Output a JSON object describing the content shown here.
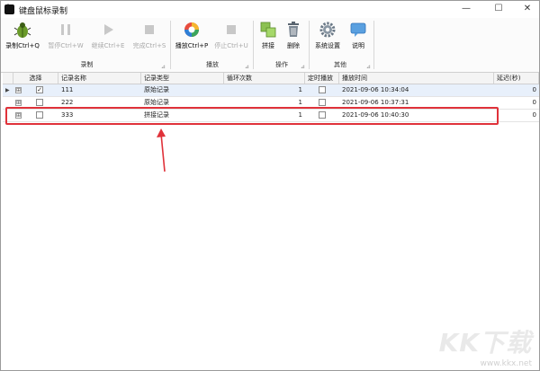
{
  "window": {
    "title": "键盘鼠标录制"
  },
  "title_buttons": {
    "minimize": "—",
    "maximize": "☐",
    "close": "✕"
  },
  "toolbar": {
    "record": "录制Ctrl+Q",
    "pause": "暂停Ctrl+W",
    "resume": "继续Ctrl+E",
    "finish": "完成Ctrl+S",
    "play": "播放Ctrl+P",
    "stop": "停止Ctrl+U",
    "splice": "拼接",
    "delete": "删除",
    "settings": "系统设置",
    "help": "说明"
  },
  "groups": {
    "record": "录制",
    "play": "播放",
    "operate": "操作",
    "other": "其他"
  },
  "table": {
    "columns": [
      "选择",
      "记录名称",
      "记录类型",
      "循环次数",
      "定时播放",
      "播放时间",
      "延迟(秒)"
    ],
    "rows": [
      {
        "expand": "⊞",
        "checked": true,
        "name": "111",
        "type": "原始记录",
        "loops": "1",
        "timed": false,
        "time": "2021-09-06 10:34:04",
        "delay": "0"
      },
      {
        "expand": "⊞",
        "checked": false,
        "name": "222",
        "type": "原始记录",
        "loops": "1",
        "timed": false,
        "time": "2021-09-06 10:37:31",
        "delay": "0"
      },
      {
        "expand": "⊞",
        "checked": false,
        "name": "333",
        "type": "拼接记录",
        "loops": "1",
        "timed": false,
        "time": "2021-09-06 10:40:30",
        "delay": "0"
      }
    ]
  },
  "watermark": {
    "logo": "KK下载",
    "url": "www.kkx.net"
  },
  "colors": {
    "annotation": "#e0323a",
    "selected_row": "#e8f0fb"
  }
}
